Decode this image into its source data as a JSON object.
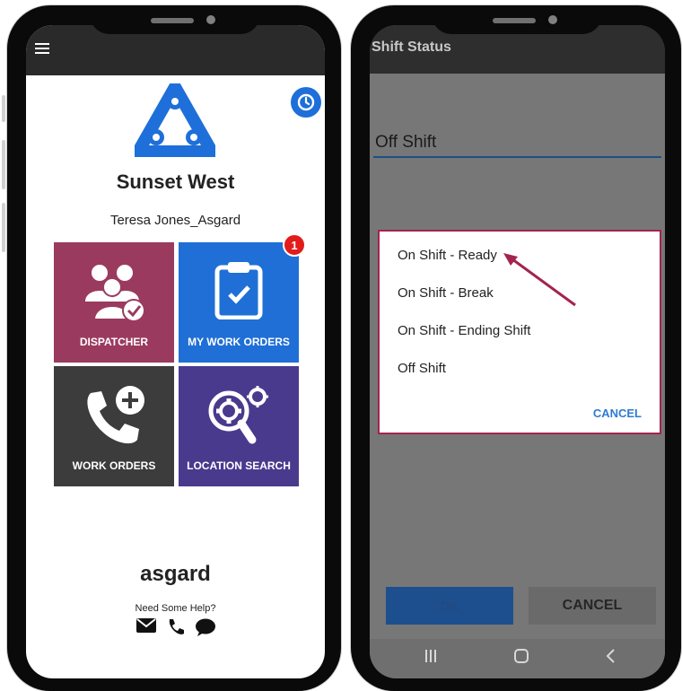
{
  "left_screen": {
    "org_name": "Sunset West",
    "user_name": "Teresa Jones_Asgard",
    "tiles": [
      {
        "label": "DISPATCHER",
        "icon": "users-check-icon",
        "color": "#9b3a5f"
      },
      {
        "label": "MY WORK ORDERS",
        "icon": "clipboard-check-icon",
        "color": "#1f6fd6",
        "badge": "1"
      },
      {
        "label": "WORK ORDERS",
        "icon": "phone-plus-icon",
        "color": "#3c3c3c"
      },
      {
        "label": "LOCATION SEARCH",
        "icon": "gears-search-icon",
        "color": "#4a3a8e"
      }
    ],
    "footer": {
      "brand": "asgard",
      "help_text": "Need Some Help?",
      "icons": [
        "envelope-icon",
        "phone-icon",
        "chat-bubble-icon"
      ]
    },
    "colors": {
      "accent": "#1e6fd9",
      "badge": "#e21b1b"
    }
  },
  "right_screen": {
    "title": "Shift Status",
    "current_status": "Off Shift",
    "dialog": {
      "options": [
        "On Shift - Ready",
        "On Shift - Break",
        "On Shift - Ending Shift",
        "Off Shift"
      ],
      "cancel_label": "CANCEL",
      "border_color": "#a3244f"
    },
    "ok_label": "OK",
    "cancel_label": "CANCEL",
    "nav": [
      "recent-apps-icon",
      "home-icon",
      "back-icon"
    ]
  }
}
